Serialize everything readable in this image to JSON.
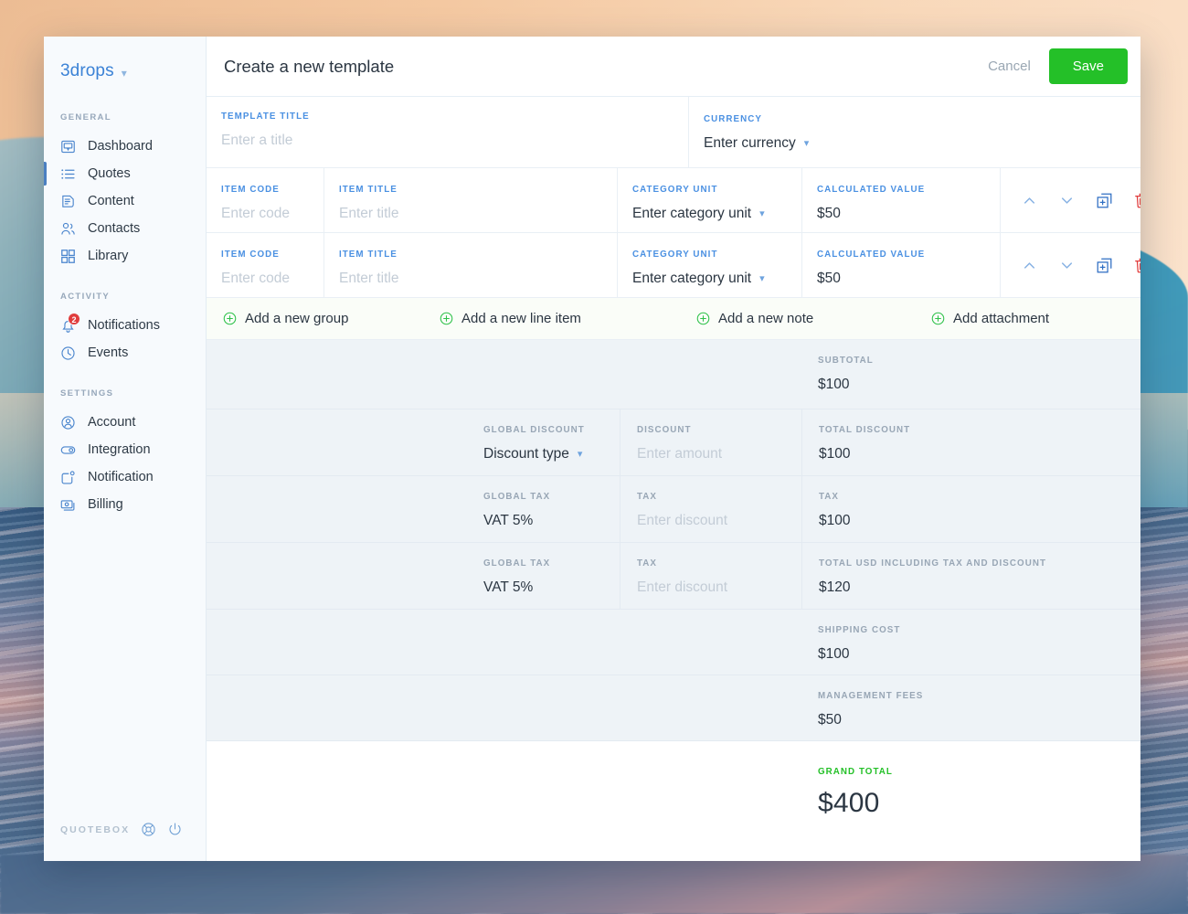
{
  "sidebar": {
    "brand": {
      "name": "3drops",
      "caret": "chevron-down-icon"
    },
    "groups": [
      {
        "heading": "GENERAL",
        "items": [
          {
            "label": "Dashboard",
            "icon": "dashboard-icon",
            "active": false
          },
          {
            "label": "Quotes",
            "icon": "list-icon",
            "active": true
          },
          {
            "label": "Content",
            "icon": "document-icon",
            "active": false
          },
          {
            "label": "Contacts",
            "icon": "contacts-icon",
            "active": false
          },
          {
            "label": "Library",
            "icon": "grid-icon",
            "active": false
          }
        ]
      },
      {
        "heading": "ACTIVITY",
        "items": [
          {
            "label": "Notifications",
            "icon": "bell-icon",
            "badge": "2",
            "active": false
          },
          {
            "label": "Events",
            "icon": "clock-icon",
            "active": false
          }
        ]
      },
      {
        "heading": "SETTINGS",
        "items": [
          {
            "label": "Account",
            "icon": "user-circle-icon",
            "active": false
          },
          {
            "label": "Integration",
            "icon": "plug-icon",
            "active": false
          },
          {
            "label": "Notification",
            "icon": "notification-icon",
            "active": false
          },
          {
            "label": "Billing",
            "icon": "billing-icon",
            "active": false
          }
        ]
      }
    ],
    "footer": {
      "brand": "QUOTEBOX",
      "help_icon": "lifebuoy-icon",
      "power_icon": "power-icon"
    }
  },
  "header": {
    "title": "Create a new template",
    "cancel_label": "Cancel",
    "save_label": "Save"
  },
  "form": {
    "template_title": {
      "label": "TEMPLATE TITLE",
      "placeholder": "Enter a title",
      "value": ""
    },
    "currency": {
      "label": "CURRENCY",
      "value": "Enter currency",
      "caret": "chevron-down-icon"
    }
  },
  "line_items": {
    "columns": {
      "code": "ITEM CODE",
      "title": "ITEM TITLE",
      "category": "CATEGORY UNIT",
      "value": "CALCULATED VALUE"
    },
    "rows": [
      {
        "code_placeholder": "Enter code",
        "title_placeholder": "Enter title",
        "category_value": "Enter category unit",
        "calculated_value": "$50"
      },
      {
        "code_placeholder": "Enter code",
        "title_placeholder": "Enter title",
        "category_value": "Enter category unit",
        "calculated_value": "$50"
      }
    ],
    "actions": {
      "move_up": "chevron-up-icon",
      "move_down": "chevron-down-icon",
      "duplicate": "duplicate-icon",
      "delete": "trash-icon"
    }
  },
  "add_actions": [
    {
      "label": "Add a new group",
      "icon": "plus-circle-icon"
    },
    {
      "label": "Add a new line item",
      "icon": "plus-circle-icon"
    },
    {
      "label": "Add a new note",
      "icon": "plus-circle-icon"
    },
    {
      "label": "Add attachment",
      "icon": "plus-circle-icon"
    }
  ],
  "totals": {
    "subtotal": {
      "label": "SUBTOTAL",
      "value": "$100"
    },
    "discount_row": {
      "global_label": "GLOBAL DISCOUNT",
      "global_value": "Discount type",
      "amount_label": "DISCOUNT",
      "amount_placeholder": "Enter amount",
      "total_label": "TOTAL DISCOUNT",
      "total_value": "$100"
    },
    "tax_row_1": {
      "global_label": "GLOBAL TAX",
      "global_value": "VAT 5%",
      "amount_label": "TAX",
      "amount_placeholder": "Enter discount",
      "total_label": "TAX",
      "total_value": "$100"
    },
    "tax_row_2": {
      "global_label": "GLOBAL TAX",
      "global_value": "VAT 5%",
      "amount_label": "TAX",
      "amount_placeholder": "Enter discount",
      "total_label": "TOTAL USD INCLUDING TAX AND DISCOUNT",
      "total_value": "$120"
    },
    "shipping": {
      "label": "SHIPPING COST",
      "value": "$100"
    },
    "management": {
      "label": "MANAGEMENT FEES",
      "value": "$50"
    },
    "grand_total": {
      "label": "GRAND TOTAL",
      "value": "$400"
    }
  },
  "colors": {
    "accent_blue": "#4a90e2",
    "brand_blue": "#3b82d6",
    "save_green": "#24c028",
    "grand_total_green": "#24c028",
    "badge_red": "#e03d3d",
    "delete_red": "#e03d3d",
    "totals_bg": "#eef3f7",
    "sidebar_bg": "#f7fafd"
  }
}
